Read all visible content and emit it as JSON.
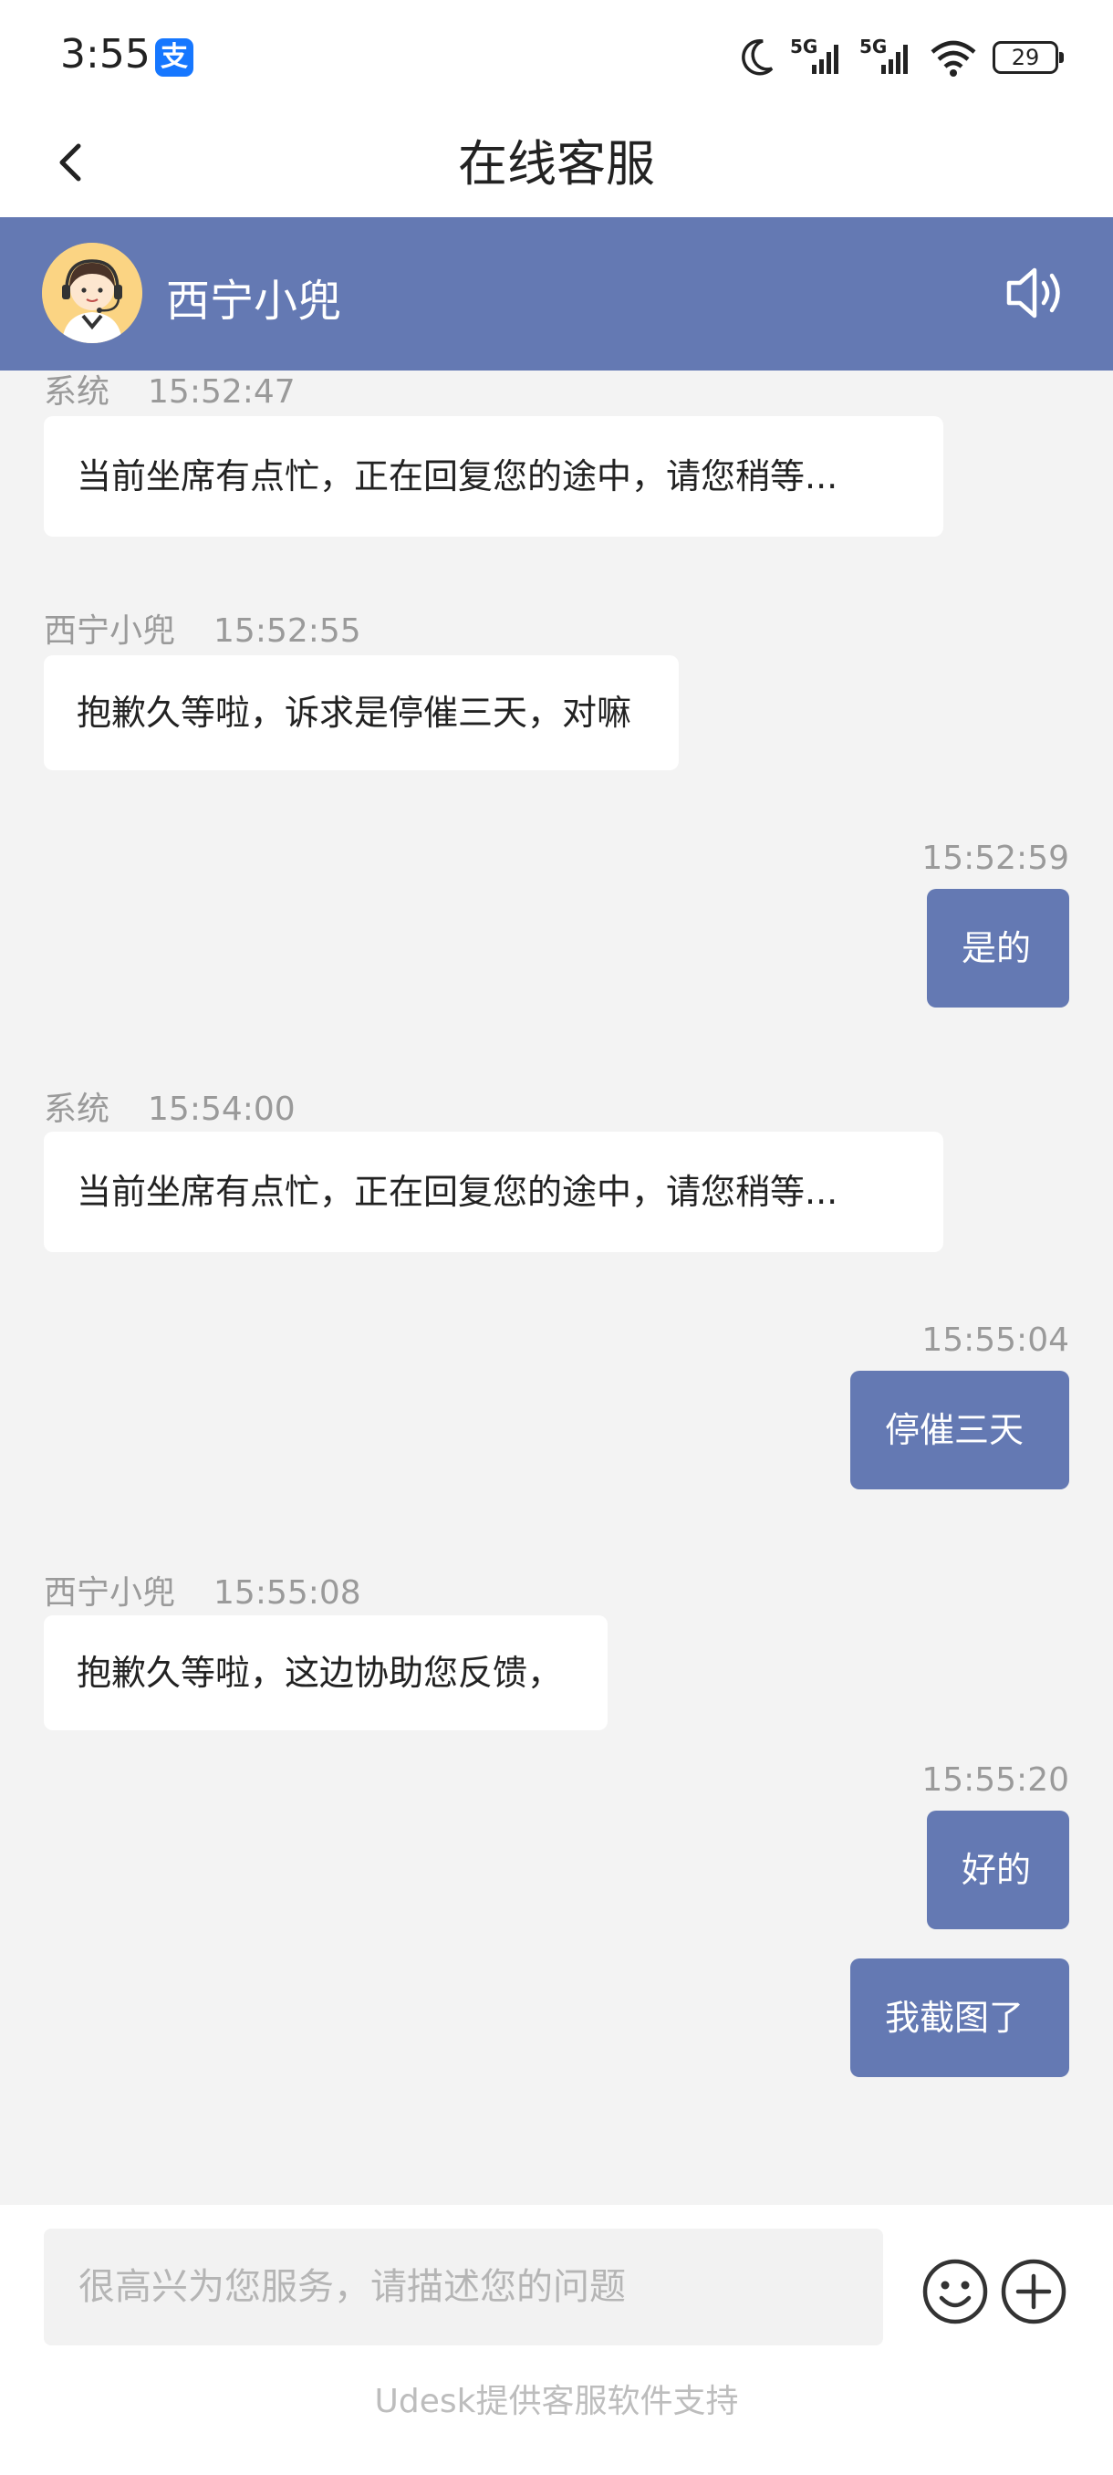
{
  "status_bar": {
    "time": "3:55",
    "app_badge": "支",
    "network_left": "5G",
    "network_right": "5G",
    "battery": "29"
  },
  "nav": {
    "title": "在线客服"
  },
  "agent": {
    "name": "西宁小兜"
  },
  "messages": [
    {
      "sender": "系统",
      "time": "15:52:47",
      "text": "当前坐席有点忙，正在回复您的途中，请您稍等..."
    },
    {
      "sender": "西宁小兜",
      "time": "15:52:55",
      "text": "抱歉久等啦，诉求是停催三天，对嘛"
    },
    {
      "time": "15:52:59",
      "text": "是的"
    },
    {
      "sender": "系统",
      "time": "15:54:00",
      "text": "当前坐席有点忙，正在回复您的途中，请您稍等..."
    },
    {
      "time": "15:55:04",
      "text": "停催三天"
    },
    {
      "sender": "西宁小兜",
      "time": "15:55:08",
      "text": "抱歉久等啦，这边协助您反馈，"
    },
    {
      "time": "15:55:20",
      "text": "好的"
    },
    {
      "text": "我截图了"
    }
  ],
  "composer": {
    "placeholder": "很高兴为您服务，请描述您的问题"
  },
  "footer": {
    "powered_by": "Udesk提供客服软件支持"
  },
  "colors": {
    "accent": "#6479b3",
    "background": "#f3f3f3",
    "bubble_in": "#ffffff",
    "meta_text": "#9a9a9a"
  },
  "icons": {
    "back": "chevron-left-icon",
    "speaker": "speaker-icon",
    "emoji": "smiley-icon",
    "plus": "plus-circle-icon"
  }
}
